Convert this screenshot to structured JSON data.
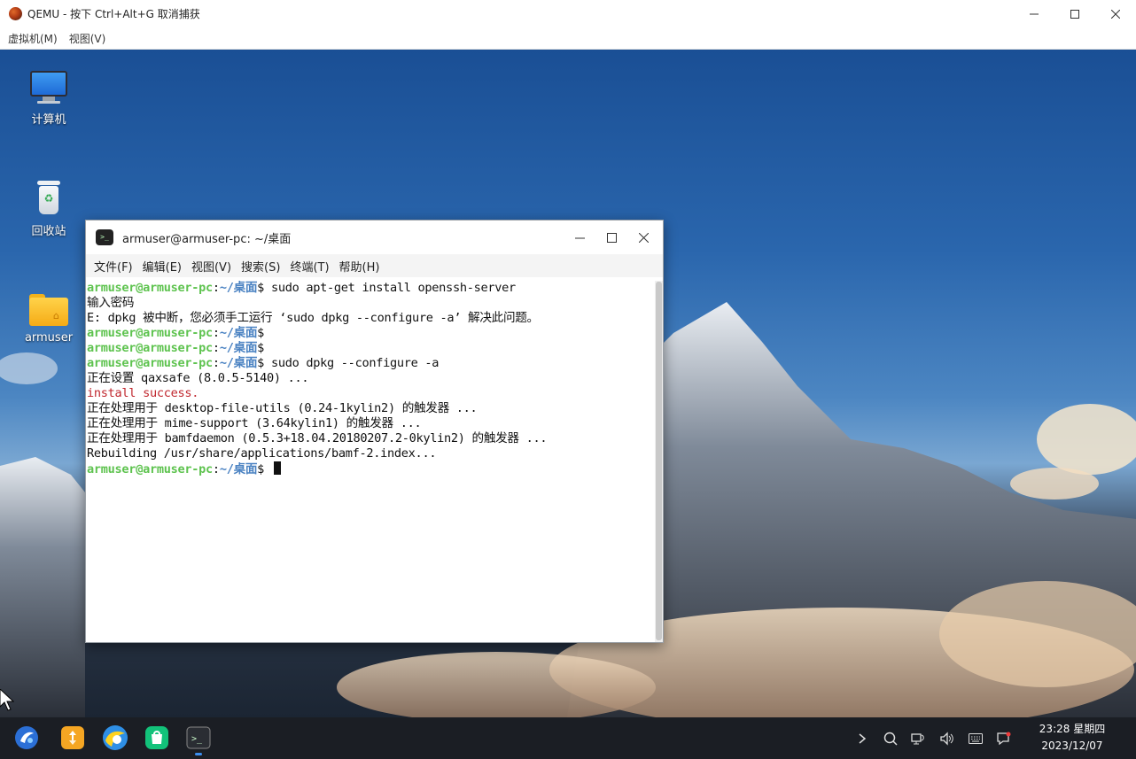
{
  "qemu": {
    "title": "QEMU - 按下 Ctrl+Alt+G 取消捕获",
    "menu": [
      "虚拟机(M)",
      "视图(V)"
    ]
  },
  "desktop": {
    "icons": [
      {
        "label": "计算机",
        "icon": "computer-icon"
      },
      {
        "label": "回收站",
        "icon": "trash-icon"
      },
      {
        "label": "armuser",
        "icon": "home-folder-icon"
      }
    ]
  },
  "terminal": {
    "title": "armuser@armuser-pc: ~/桌面",
    "menu": [
      "文件(F)",
      "编辑(E)",
      "视图(V)",
      "搜索(S)",
      "终端(T)",
      "帮助(H)"
    ],
    "prompt_user": "armuser@armuser-pc",
    "prompt_sep": ":",
    "prompt_path": "~/桌面",
    "prompt_end": "$ ",
    "lines": [
      {
        "kind": "prompt",
        "text": "sudo apt-get install openssh-server"
      },
      {
        "kind": "text",
        "text": "输入密码"
      },
      {
        "kind": "text",
        "text": "E: dpkg 被中断，您必须手工运行 ‘sudo dpkg --configure -a’ 解决此问题。"
      },
      {
        "kind": "prompt",
        "text": ""
      },
      {
        "kind": "prompt",
        "text": ""
      },
      {
        "kind": "prompt",
        "text": "sudo dpkg --configure -a"
      },
      {
        "kind": "text",
        "text": "正在设置 qaxsafe (8.0.5-5140) ..."
      },
      {
        "kind": "red",
        "text": "install success."
      },
      {
        "kind": "text",
        "text": "正在处理用于 desktop-file-utils (0.24-1kylin2) 的触发器 ..."
      },
      {
        "kind": "text",
        "text": "正在处理用于 mime-support (3.64kylin1) 的触发器 ..."
      },
      {
        "kind": "text",
        "text": "正在处理用于 bamfdaemon (0.5.3+18.04.20180207.2-0kylin2) 的触发器 ..."
      },
      {
        "kind": "text",
        "text": "Rebuilding /usr/share/applications/bamf-2.index..."
      },
      {
        "kind": "cursor",
        "text": ""
      }
    ]
  },
  "taskbar": {
    "apps": [
      "start-menu-icon",
      "file-transfer-icon",
      "browser-icon",
      "app-store-icon",
      "terminal-icon"
    ],
    "active_app": "terminal-icon",
    "tray": [
      "expand-tray-icon",
      "search-icon",
      "network-icon",
      "volume-icon",
      "keyboard-icon",
      "notification-icon"
    ],
    "time": "23:28 星期四",
    "date": "2023/12/07"
  },
  "colors": {
    "prompt_user": "#5ec34f",
    "prompt_path": "#4a82c2",
    "error_red": "#c0262d",
    "taskbar_bg": "#1b1e24",
    "active_indicator": "#3b8ef0"
  }
}
